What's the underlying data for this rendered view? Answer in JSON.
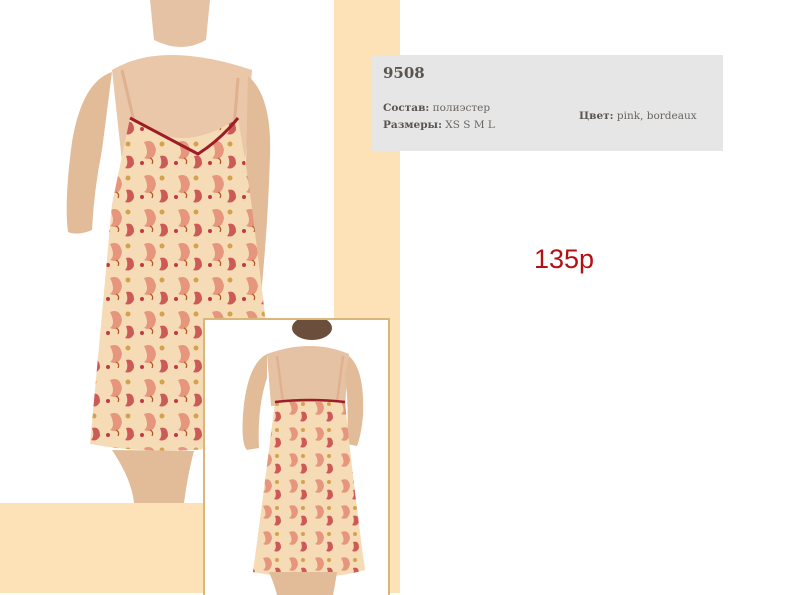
{
  "product": {
    "sku": "9508",
    "composition_label": "Состав:",
    "composition_value": "полиэстер",
    "sizes_label": "Размеры:",
    "sizes_value": "XS S M L",
    "color_label": "Цвет:",
    "color_value": "pink, bordeaux",
    "price": "135р"
  },
  "colors": {
    "band": "#fde2b8",
    "info_box": "#e6e6e6",
    "price": "#b31014",
    "fabric_base": "#f6dcb6",
    "paisley_red": "#c2393f",
    "trim": "#9e1c26"
  },
  "images": {
    "front_photo": "model-front-paisley-chemise",
    "back_photo": "model-back-paisley-chemise"
  }
}
